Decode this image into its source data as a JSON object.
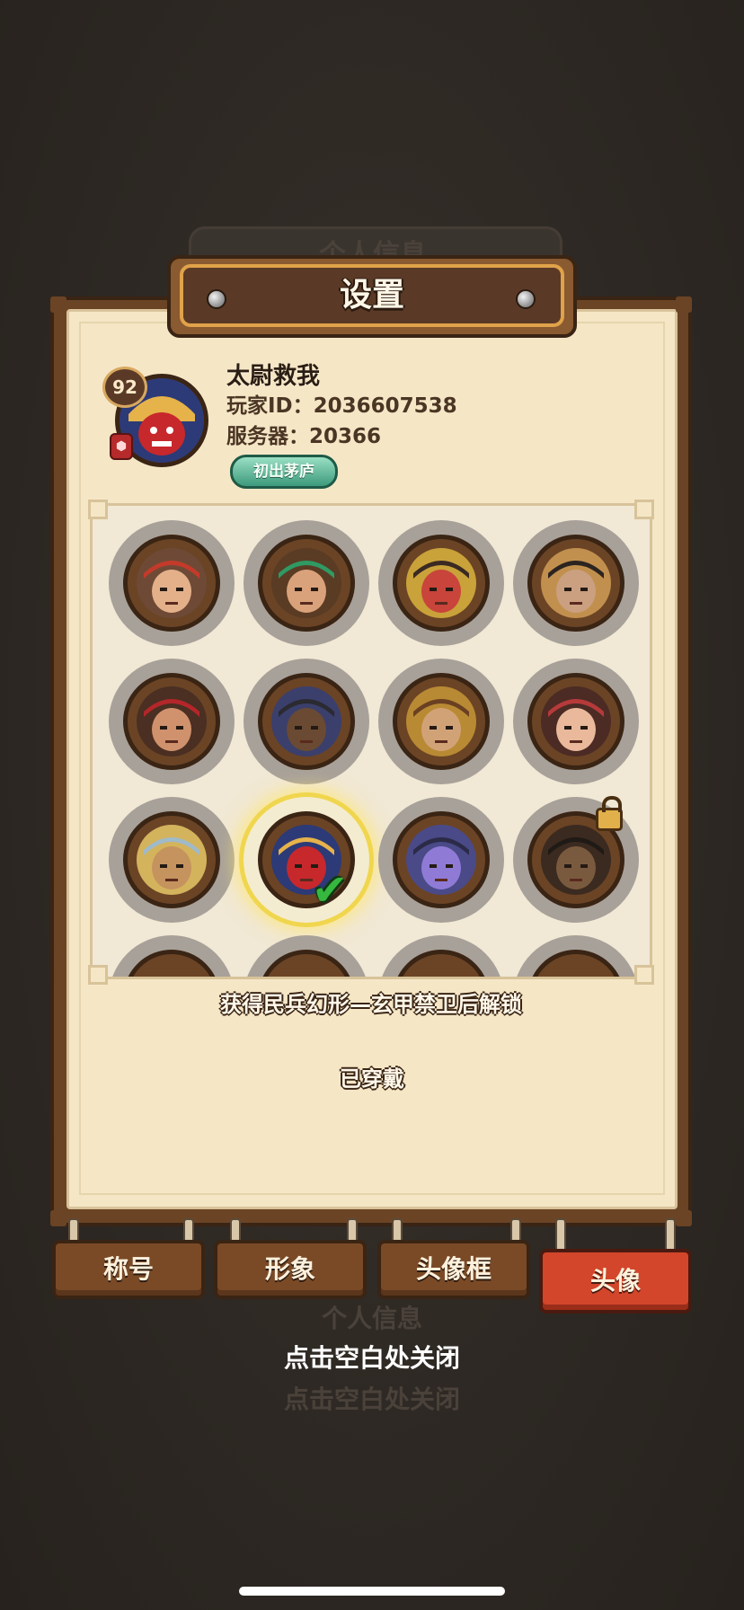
{
  "background": {
    "ghost_title": "个人信息",
    "ghost_close": "点击空白处关闭"
  },
  "panel": {
    "title": "设置"
  },
  "profile": {
    "level": "92",
    "name": "太尉救我",
    "player_id_label": "玩家ID：",
    "player_id": "2036607538",
    "server_label": "服务器：",
    "server": "20366",
    "title_badge": "初出茅庐"
  },
  "avatars": [
    {
      "name": "avatar-1",
      "colors": [
        "#6e4a36",
        "#e3b08a",
        "#c43a2a"
      ],
      "state": "normal"
    },
    {
      "name": "avatar-2",
      "colors": [
        "#5a3b24",
        "#d9a27b",
        "#2f9a63"
      ],
      "state": "normal"
    },
    {
      "name": "avatar-3",
      "colors": [
        "#c9a23a",
        "#c9443a",
        "#3a2a22"
      ],
      "state": "normal"
    },
    {
      "name": "avatar-4",
      "colors": [
        "#c2904e",
        "#caa081",
        "#2b2420"
      ],
      "state": "normal"
    },
    {
      "name": "avatar-5",
      "colors": [
        "#4a2f22",
        "#d0916d",
        "#b3262a"
      ],
      "state": "normal"
    },
    {
      "name": "avatar-6",
      "colors": [
        "#3b3f6b",
        "#6a4a32",
        "#2a2a30"
      ],
      "state": "normal"
    },
    {
      "name": "avatar-7",
      "colors": [
        "#b98a34",
        "#d2a277",
        "#6a4022"
      ],
      "state": "normal"
    },
    {
      "name": "avatar-8",
      "colors": [
        "#4b2b24",
        "#eab89b",
        "#b63a3a"
      ],
      "state": "normal"
    },
    {
      "name": "avatar-9",
      "colors": [
        "#d4b35d",
        "#c5935e",
        "#9fbac8"
      ],
      "state": "normal"
    },
    {
      "name": "avatar-10",
      "colors": [
        "#2c3a77",
        "#c7282c",
        "#e6b24a"
      ],
      "state": "selected"
    },
    {
      "name": "avatar-11",
      "colors": [
        "#4a4a88",
        "#8f7bd6",
        "#2b2b48"
      ],
      "state": "normal"
    },
    {
      "name": "avatar-12",
      "colors": [
        "#3b2a20",
        "#7a5a3e",
        "#1f1a15"
      ],
      "state": "locked"
    }
  ],
  "unlock_hint": "获得民兵幻形—玄甲禁卫后解锁",
  "worn_status": "已穿戴",
  "tabs": [
    {
      "label": "称号",
      "active": false
    },
    {
      "label": "形象",
      "active": false
    },
    {
      "label": "头像框",
      "active": false
    },
    {
      "label": "头像",
      "active": true
    }
  ],
  "close_hint": "点击空白处关闭",
  "colors": {
    "panel_wood": "#6b4425",
    "paper": "#f5e7c6",
    "tab_active": "#d3462b",
    "selected_glow": "#f0d64e"
  }
}
